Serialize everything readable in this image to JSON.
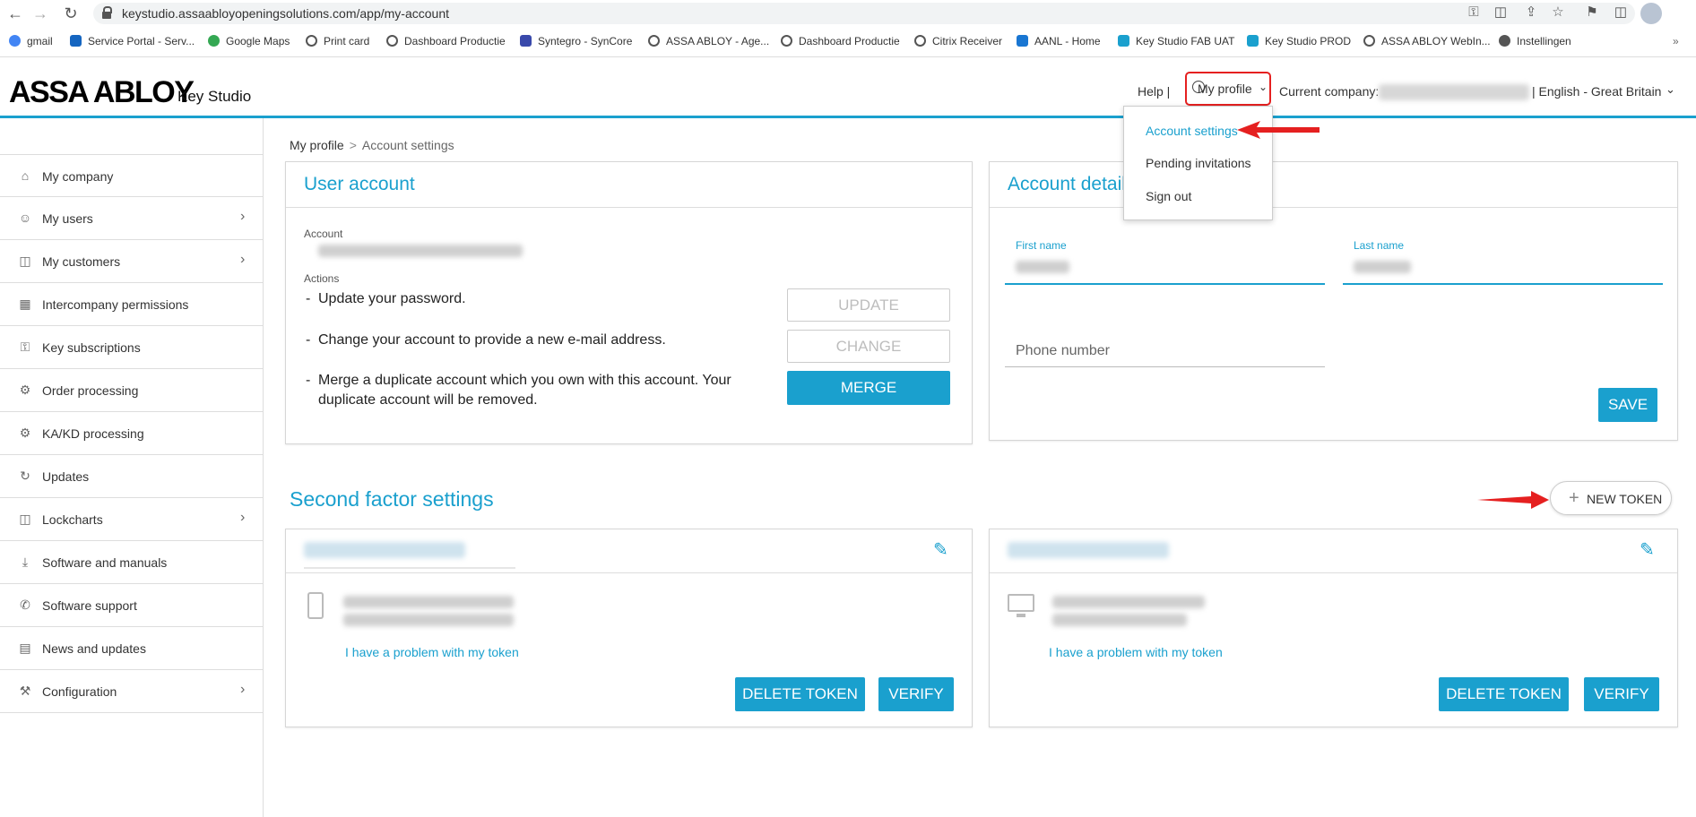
{
  "browser": {
    "url": "keystudio.assaabloyopeningsolutions.com/app/my-account",
    "bookmarks": [
      {
        "label": "gmail",
        "color": "#4285f4"
      },
      {
        "label": "Service Portal - Serv...",
        "color": "#1565c0"
      },
      {
        "label": "Google Maps",
        "color": "#34a853"
      },
      {
        "label": "Print card",
        "color": "#555555"
      },
      {
        "label": "Dashboard Productie",
        "color": "#555555"
      },
      {
        "label": "Syntegro - SynCore",
        "color": "#3949ab"
      },
      {
        "label": "ASSA ABLOY - Age...",
        "color": "#555555"
      },
      {
        "label": "Dashboard Productie",
        "color": "#555555"
      },
      {
        "label": "Citrix Receiver",
        "color": "#555555"
      },
      {
        "label": "AANL - Home",
        "color": "#1976d2"
      },
      {
        "label": "Key Studio FAB UAT",
        "color": "#1aa0ce"
      },
      {
        "label": "Key Studio PROD",
        "color": "#1aa0ce"
      },
      {
        "label": "ASSA ABLOY WebIn...",
        "color": "#555555"
      },
      {
        "label": "Instellingen",
        "color": "#555555"
      }
    ]
  },
  "header": {
    "logo": "ASSA ABLOY",
    "product": "Key Studio",
    "help": "Help |",
    "profile": "My profile",
    "company_label": "Current company:",
    "language": "|  English - Great Britain"
  },
  "dropdown": {
    "items": [
      "Account settings",
      "Pending invitations",
      "Sign out"
    ]
  },
  "sidebar": {
    "items": [
      {
        "label": "My company",
        "icon": "home-icon",
        "chevron": false
      },
      {
        "label": "My users",
        "icon": "user-icon",
        "chevron": true
      },
      {
        "label": "My customers",
        "icon": "lock-icon",
        "chevron": true
      },
      {
        "label": "Intercompany permissions",
        "icon": "building-icon",
        "chevron": false
      },
      {
        "label": "Key subscriptions",
        "icon": "key-icon",
        "chevron": false
      },
      {
        "label": "Order processing",
        "icon": "gear-icon",
        "chevron": false
      },
      {
        "label": "KA/KD processing",
        "icon": "gears-icon",
        "chevron": false
      },
      {
        "label": "Updates",
        "icon": "update-icon",
        "chevron": false
      },
      {
        "label": "Lockcharts",
        "icon": "chart-icon",
        "chevron": true
      },
      {
        "label": "Software and manuals",
        "icon": "download-icon",
        "chevron": false
      },
      {
        "label": "Software support",
        "icon": "phone-icon",
        "chevron": false
      },
      {
        "label": "News and updates",
        "icon": "news-icon",
        "chevron": false
      },
      {
        "label": "Configuration",
        "icon": "wrench-icon",
        "chevron": true
      }
    ]
  },
  "breadcrumb": {
    "root": "My profile",
    "sep": ">",
    "current": "Account settings"
  },
  "user_account": {
    "title": "User account",
    "account_label": "Account",
    "actions_label": "Actions",
    "actions": [
      {
        "text": "Update your password.",
        "button": "UPDATE",
        "enabled": false
      },
      {
        "text": "Change your account to provide a new e-mail address.",
        "button": "CHANGE",
        "enabled": false
      },
      {
        "text": "Merge a duplicate account which you own with this account. Your duplicate account will be removed.",
        "button": "MERGE",
        "enabled": true
      }
    ]
  },
  "account_details": {
    "title": "Account details",
    "first_name_label": "First name",
    "last_name_label": "Last name",
    "phone_placeholder": "Phone number",
    "save": "SAVE"
  },
  "second_factor": {
    "title": "Second factor settings",
    "new_token": "NEW TOKEN",
    "tokens": [
      {
        "device": "phone-icon",
        "problem_link": "I have a problem with my token",
        "delete": "DELETE TOKEN",
        "verify": "VERIFY"
      },
      {
        "device": "monitor-icon",
        "problem_link": "I have a problem with my token",
        "delete": "DELETE TOKEN",
        "verify": "VERIFY"
      }
    ]
  },
  "colors": {
    "accent": "#1aa0ce",
    "highlight": "#e52020"
  }
}
